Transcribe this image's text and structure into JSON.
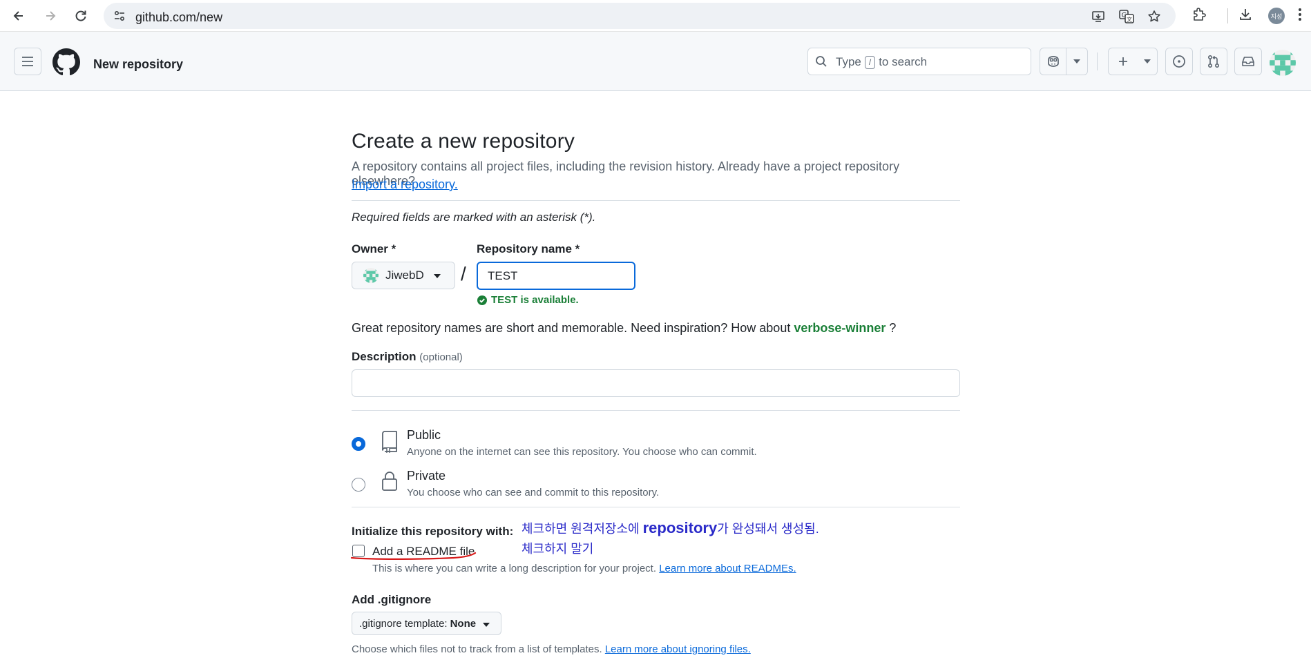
{
  "browser": {
    "url": "github.com/new",
    "profile_initials": "지성"
  },
  "header": {
    "title": "New repository",
    "search_prefix": "Type",
    "search_key": "/",
    "search_suffix": "to search"
  },
  "form": {
    "heading": "Create a new repository",
    "subtitle": "A repository contains all project files, including the revision history. Already have a project repository elsewhere?",
    "import_link": "Import a repository.",
    "required_note": "Required fields are marked with an asterisk (*).",
    "owner_label": "Owner *",
    "owner_value": "JiwebD",
    "slash": "/",
    "repo_name_label": "Repository name *",
    "repo_name_value": "TEST",
    "availability": "TEST is available.",
    "inspiration_text": "Great repository names are short and memorable. Need inspiration? How about",
    "inspiration_suggestion": "verbose-winner",
    "inspiration_end": "?",
    "description_label": "Description",
    "description_optional": "(optional)",
    "visibility": {
      "public_title": "Public",
      "public_desc": "Anyone on the internet can see this repository. You choose who can commit.",
      "private_title": "Private",
      "private_desc": "You choose who can see and commit to this repository."
    },
    "init_label": "Initialize this repository with:",
    "readme_label": "Add a README file",
    "readme_desc": "This is where you can write a long description for your project.",
    "readme_link": "Learn more about READMEs.",
    "gitignore_label": "Add .gitignore",
    "gitignore_prefix": ".gitignore template:",
    "gitignore_value": "None",
    "gitignore_help": "Choose which files not to track from a list of templates.",
    "gitignore_link": "Learn more about ignoring files."
  },
  "annotation": {
    "line1_before": "체크하면 원격저장소에",
    "line1_word": "repository",
    "line1_after": "가 완성돼서 생성됨.",
    "line2": "체크하지 말기",
    "color": "#2b2bc9",
    "underline_color": "#d81b1b"
  },
  "colors": {
    "accent": "#0969da",
    "success": "#1a7f37"
  }
}
